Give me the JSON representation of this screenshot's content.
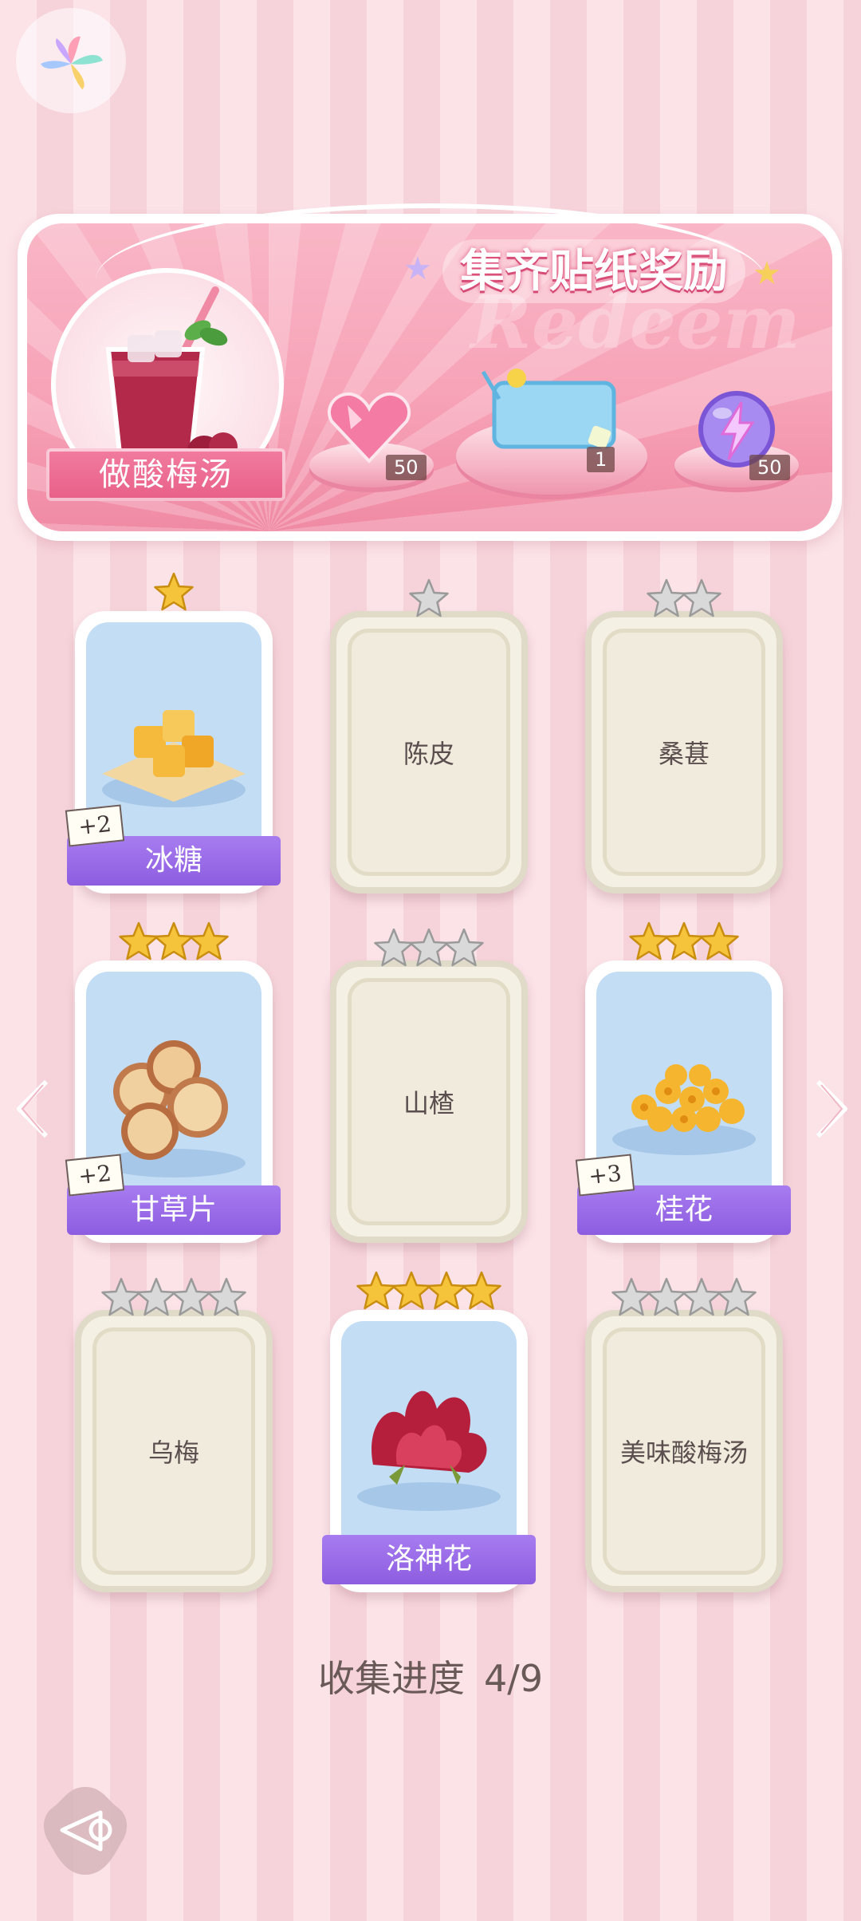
{
  "banner": {
    "title": "集齐贴纸奖励",
    "watermark": "Redeem",
    "drink_name": "做酸梅汤",
    "rewards": [
      {
        "icon": "pink-heart-gem-icon",
        "count": "50"
      },
      {
        "icon": "blue-card-drink-icon",
        "count": "1"
      },
      {
        "icon": "purple-lightning-orb-icon",
        "count": "50"
      }
    ]
  },
  "cards": [
    {
      "name": "冰糖",
      "stars": 1,
      "star_color": "gold",
      "collected": true,
      "bonus": "+2",
      "icon": "rock-sugar-icon"
    },
    {
      "name": "陈皮",
      "stars": 1,
      "star_color": "gray",
      "collected": false,
      "bonus": "",
      "icon": ""
    },
    {
      "name": "桑葚",
      "stars": 2,
      "star_color": "gray",
      "collected": false,
      "bonus": "",
      "icon": ""
    },
    {
      "name": "甘草片",
      "stars": 3,
      "star_color": "gold",
      "collected": true,
      "bonus": "+2",
      "icon": "licorice-slices-icon"
    },
    {
      "name": "山楂",
      "stars": 3,
      "star_color": "gray",
      "collected": false,
      "bonus": "",
      "icon": ""
    },
    {
      "name": "桂花",
      "stars": 3,
      "star_color": "gold",
      "collected": true,
      "bonus": "+3",
      "icon": "osmanthus-icon"
    },
    {
      "name": "乌梅",
      "stars": 4,
      "star_color": "gray",
      "collected": false,
      "bonus": "",
      "icon": ""
    },
    {
      "name": "洛神花",
      "stars": 4,
      "star_color": "gold",
      "collected": true,
      "bonus": "",
      "icon": "roselle-icon"
    },
    {
      "name": "美味酸梅汤",
      "stars": 4,
      "star_color": "gray",
      "collected": false,
      "bonus": "",
      "icon": ""
    }
  ],
  "progress": {
    "label": "收集进度",
    "value": "4/9",
    "collected": 4,
    "total": 9
  },
  "colors": {
    "accent_purple": "#9b6be8",
    "accent_pink": "#f27ca0",
    "star_gold": "#f6c43a",
    "star_gray": "#c9c9c9"
  }
}
